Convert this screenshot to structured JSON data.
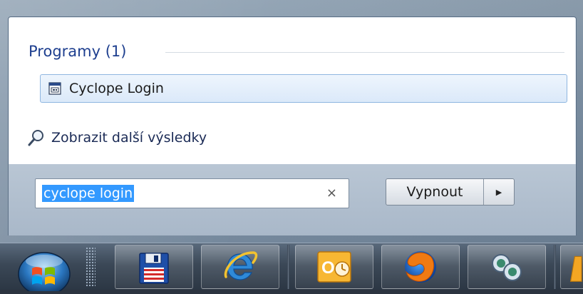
{
  "start_menu": {
    "group_header": "Programy (1)",
    "results": [
      {
        "label": "Cyclope Login",
        "icon": "app-window-icon"
      }
    ],
    "more_results_label": "Zobrazit další výsledky",
    "search": {
      "value": "cyclope login",
      "clear_glyph": "×"
    },
    "shutdown": {
      "label": "Vypnout",
      "arrow_glyph": "▶"
    }
  },
  "taskbar": {
    "items": [
      {
        "name": "start-orb",
        "icon": "windows-logo-icon"
      },
      {
        "name": "save-app",
        "icon": "floppy-disk-icon"
      },
      {
        "name": "internet-explorer",
        "icon": "internet-explorer-icon"
      },
      {
        "name": "outlook",
        "icon": "outlook-icon"
      },
      {
        "name": "firefox",
        "icon": "firefox-icon"
      },
      {
        "name": "chat-app",
        "icon": "chat-bubbles-icon"
      }
    ]
  },
  "colors": {
    "accent": "#1e3f8f",
    "selection": "#3399ff",
    "highlight_border": "#8fb6e0"
  }
}
